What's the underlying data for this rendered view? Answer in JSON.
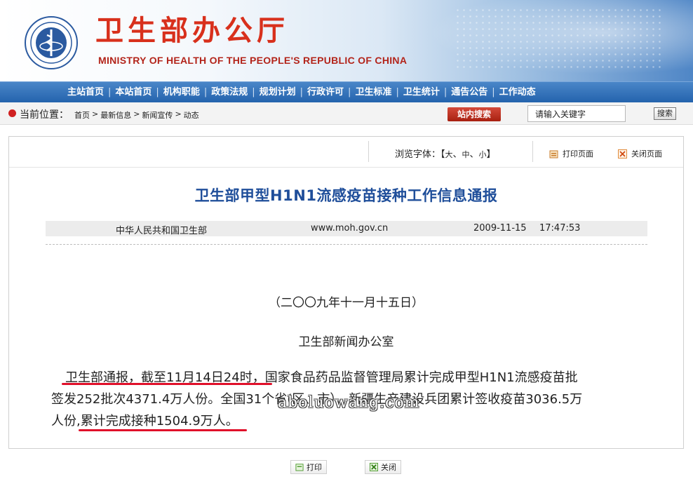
{
  "header": {
    "title_cn": "卫生部办公厅",
    "title_en": "MINISTRY OF HEALTH OF THE PEOPLE'S REPUBLIC OF CHINA",
    "emblem_icon": "ministry-emblem-icon"
  },
  "nav": {
    "items": [
      "主站首页",
      "本站首页",
      "机构职能",
      "政策法规",
      "规划计划",
      "行政许可",
      "卫生标准",
      "卫生统计",
      "通告公告",
      "工作动态"
    ]
  },
  "location": {
    "label": "当前位置：",
    "crumbs": [
      "首页",
      "最新信息",
      "新闻宣传",
      "动态"
    ],
    "site_search_label": "站内搜索",
    "keyword_value": "请输入关键字",
    "search_button": "搜索"
  },
  "toolbar": {
    "font_size_label": "浏览字体：【",
    "font_large": "大",
    "font_medium": "中",
    "font_small": "小",
    "font_close": "】",
    "print_page": "打印页面",
    "close_page": "关闭页面"
  },
  "article": {
    "title": "卫生部甲型H1N1流感疫苗接种工作信息通报",
    "source": "中华人民共和国卫生部",
    "url": "www.moh.gov.cn",
    "date": "2009-11-15",
    "time": "17:47:53",
    "date_line": "（二〇〇九年十一月十五日）",
    "office_line": "卫生部新闻办公室",
    "body_lines": [
      "卫生部通报，截至11月14日24时，国家食品药品监督管理局累计完成甲型H1N1流感疫苗批",
      "签发252批次4371.4万人份。全国31个省(区、市）、新疆生产建设兵团累计签收疫苗3036.5万",
      "人份,累计完成接种1504.9万人。"
    ]
  },
  "watermark": "aboluowang.com",
  "bottom": {
    "print": "打印",
    "close": "关闭"
  },
  "colors": {
    "nav_bg": "#2463ad",
    "title_red": "#d8301c",
    "article_title_blue": "#1f4e9a",
    "underline_red": "#e0102a"
  }
}
